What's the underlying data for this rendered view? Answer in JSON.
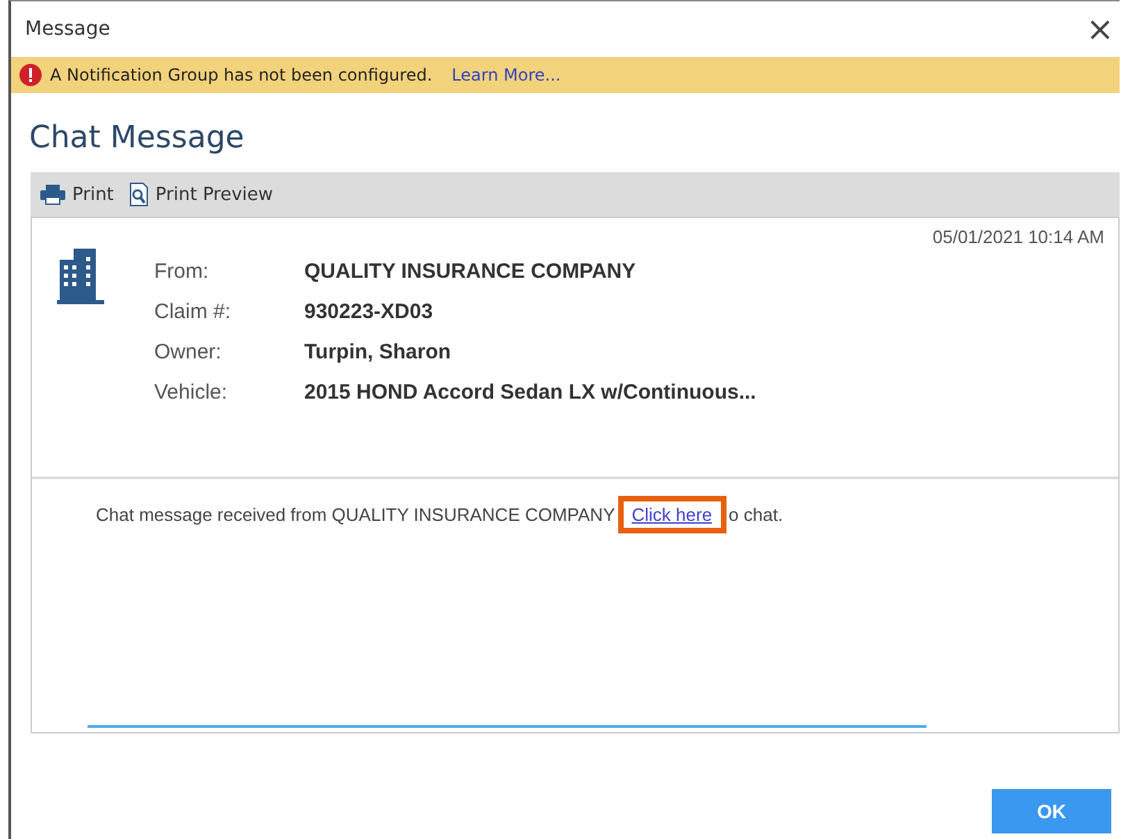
{
  "window": {
    "title": "Message",
    "close": "×"
  },
  "alert": {
    "text": "A Notification Group has not been configured.",
    "link": "Learn More..."
  },
  "heading": "Chat Message",
  "toolbar": [
    {
      "kind": "print",
      "label": "Print"
    },
    {
      "kind": "preview",
      "label": "Print Preview"
    }
  ],
  "message": {
    "timestamp": "05/01/2021 10:14 AM",
    "fields": [
      {
        "label": "From:",
        "value": "QUALITY INSURANCE COMPANY"
      },
      {
        "label": "Claim #:",
        "value": "930223-XD03"
      },
      {
        "label": "Owner:",
        "value": "Turpin, Sharon"
      },
      {
        "label": "Vehicle:",
        "value": "2015 HOND Accord Sedan LX w/Continuous..."
      }
    ],
    "body_before": "Chat message received from QUALITY INSURANCE COMPANY",
    "body_link": "Click here",
    "body_after": "o chat."
  },
  "buttons": [
    "OK"
  ]
}
